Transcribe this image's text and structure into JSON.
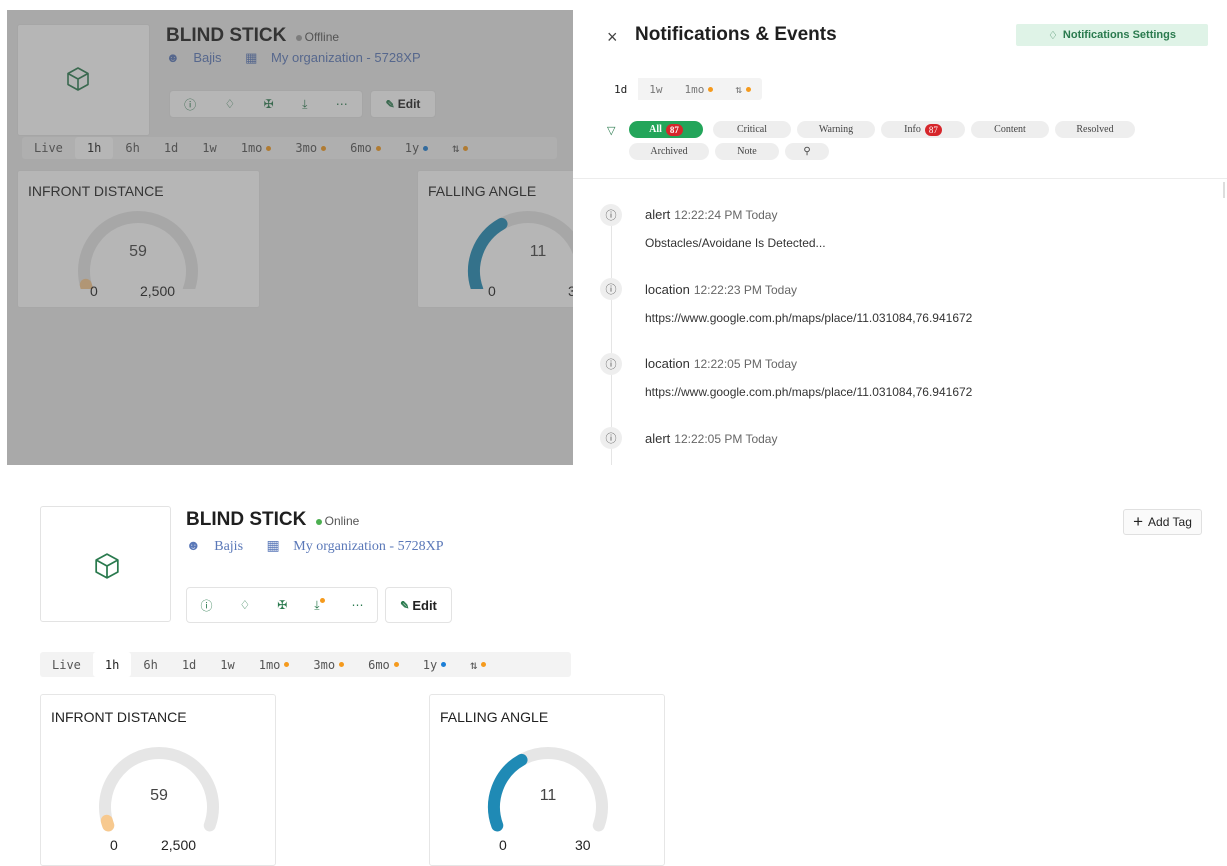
{
  "device": {
    "name": "BLIND STICK",
    "status_offline": "Offline",
    "status_online": "Online",
    "owner": "Bajis",
    "organization": "My organization - 5728XP",
    "edit_label": "Edit",
    "add_tag_label": "Add Tag"
  },
  "colors": {
    "accent_green": "#2a7a4e",
    "online_dot": "#4caf50",
    "offline_dot": "#9e9e9e",
    "gauge_fill_blue": "#1f8ab5",
    "gauge_track": "#e6e6e6",
    "gauge_min_marker": "#f7c98f",
    "badge_red": "#d6262b"
  },
  "action_icons": [
    "info-icon",
    "bell-icon",
    "wrench-icon",
    "download-icon",
    "more-icon"
  ],
  "time_ranges": [
    {
      "label": "Live",
      "dot": ""
    },
    {
      "label": "1h",
      "dot": "",
      "selected": true
    },
    {
      "label": "6h",
      "dot": ""
    },
    {
      "label": "1d",
      "dot": ""
    },
    {
      "label": "1w",
      "dot": ""
    },
    {
      "label": "1mo",
      "dot": "orange"
    },
    {
      "label": "3mo",
      "dot": "orange"
    },
    {
      "label": "6mo",
      "dot": "orange"
    },
    {
      "label": "1y",
      "dot": "blue"
    },
    {
      "label": "custom",
      "dot": "orange"
    }
  ],
  "widgets": {
    "infront": {
      "title": "INFRONT DISTANCE",
      "value": "59",
      "min": "0",
      "max": "2,500",
      "fraction": 0.0236
    },
    "falling": {
      "title": "FALLING ANGLE",
      "value": "11",
      "min": "0",
      "max": "30",
      "top_max": "3",
      "fraction": 0.3667
    }
  },
  "notifications": {
    "close_label": "×",
    "title": "Notifications & Events",
    "settings_label": "Notifications Settings",
    "ranges": [
      {
        "label": "1d",
        "selected": true
      },
      {
        "label": "1w"
      },
      {
        "label": "1mo",
        "dot": "orange"
      },
      {
        "label": "custom",
        "dot": "orange"
      }
    ],
    "filters": {
      "all": "All",
      "all_count": "87",
      "critical": "Critical",
      "warning": "Warning",
      "info": "Info",
      "info_count": "87",
      "content": "Content",
      "resolved": "Resolved",
      "archived": "Archived",
      "note": "Note"
    },
    "events": [
      {
        "type": "alert",
        "time": "12:22:24 PM Today",
        "body": "Obstacles/Avoidane Is Detected..."
      },
      {
        "type": "location",
        "time": "12:22:23 PM Today",
        "body": "https://www.google.com.ph/maps/place/11.031084,76.941672"
      },
      {
        "type": "location",
        "time": "12:22:05 PM Today",
        "body": "https://www.google.com.ph/maps/place/11.031084,76.941672"
      },
      {
        "type": "alert",
        "time": "12:22:05 PM Today",
        "body": ""
      }
    ]
  }
}
